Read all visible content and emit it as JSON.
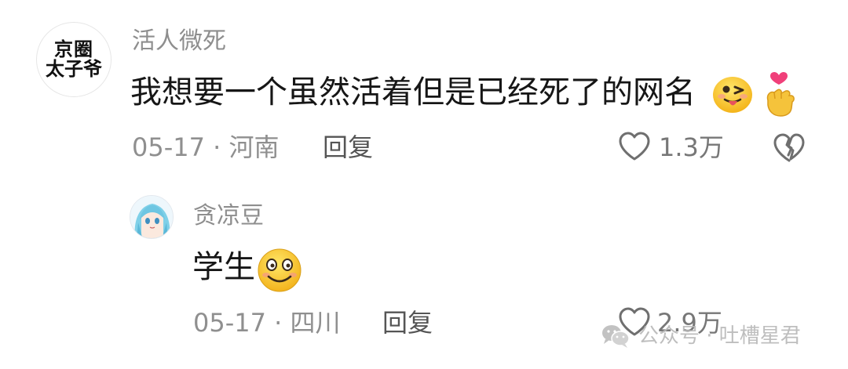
{
  "main_comment": {
    "avatar_text_line1": "京圈",
    "avatar_text_line2": "太子爷",
    "username": "活人微死",
    "text": "我想要一个虽然活着但是已经死了的网名",
    "emojis": [
      "winking-tongue-emoji",
      "finger-heart-emoji"
    ],
    "meta": "05-17 · 河南",
    "reply_label": "回复",
    "like_count": "1.3万",
    "icons": {
      "like": "heart-outline-icon",
      "dislike": "broken-heart-icon"
    }
  },
  "reply_comment": {
    "avatar": "anime-girl-avatar",
    "username": "贪凉豆",
    "text": "学生",
    "emojis": [
      "smile-emoji"
    ],
    "meta": "05-17 · 四川",
    "reply_label": "回复",
    "like_count": "2.9万",
    "icons": {
      "like": "heart-outline-icon"
    }
  },
  "watermark": {
    "text": "公众号 · 吐槽星君",
    "icon": "wechat-icon"
  },
  "colors": {
    "username": "#8e8e8e",
    "text": "#161616",
    "meta": "#8f8f8f"
  }
}
